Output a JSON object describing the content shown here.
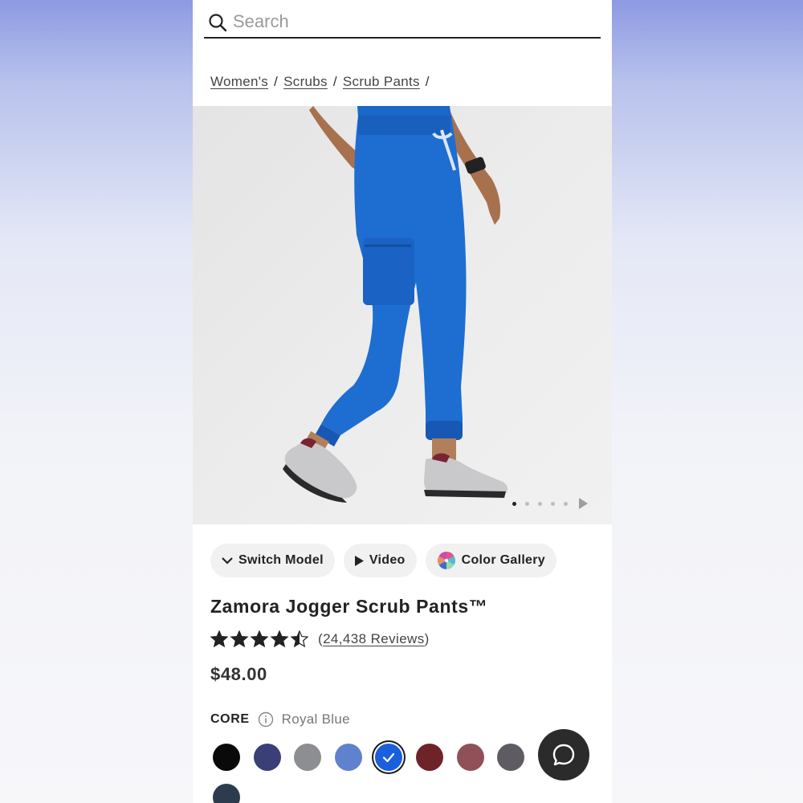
{
  "search": {
    "placeholder": "Search",
    "value": ""
  },
  "breadcrumb": [
    {
      "label": "Women's"
    },
    {
      "label": "Scrubs"
    },
    {
      "label": "Scrub Pants"
    }
  ],
  "breadcrumb_separator": "/",
  "gallery": {
    "slide_count": 5,
    "active_slide": 1
  },
  "actions": {
    "switch_model": "Switch Model",
    "video": "Video",
    "color_gallery": "Color Gallery"
  },
  "product": {
    "title": "Zamora Jogger Scrub Pants™",
    "rating": 4.5,
    "reviews_open": "(",
    "reviews_label": "24,438 Reviews",
    "reviews_close": ")",
    "price": "$48.00"
  },
  "colors": {
    "group_label": "CORE",
    "selected_name": "Royal Blue",
    "swatches": [
      {
        "name": "Black",
        "hex": "#0a0a0a"
      },
      {
        "name": "Navy",
        "hex": "#3a3f78"
      },
      {
        "name": "Gray",
        "hex": "#8d8e92"
      },
      {
        "name": "Ceil Blue",
        "hex": "#5f82cf"
      },
      {
        "name": "Royal Blue",
        "hex": "#1a5fdc",
        "selected": true
      },
      {
        "name": "Burgundy",
        "hex": "#6e2328"
      },
      {
        "name": "Mauve",
        "hex": "#8f5157"
      },
      {
        "name": "Graphite",
        "hex": "#5f5b63"
      },
      {
        "name": "Charcoal",
        "hex": "#2c3b4d"
      }
    ]
  },
  "theme": {
    "accent": "#1a5fdc",
    "pants": "#1e6ed1",
    "chat_bg": "#2b2b2b"
  }
}
